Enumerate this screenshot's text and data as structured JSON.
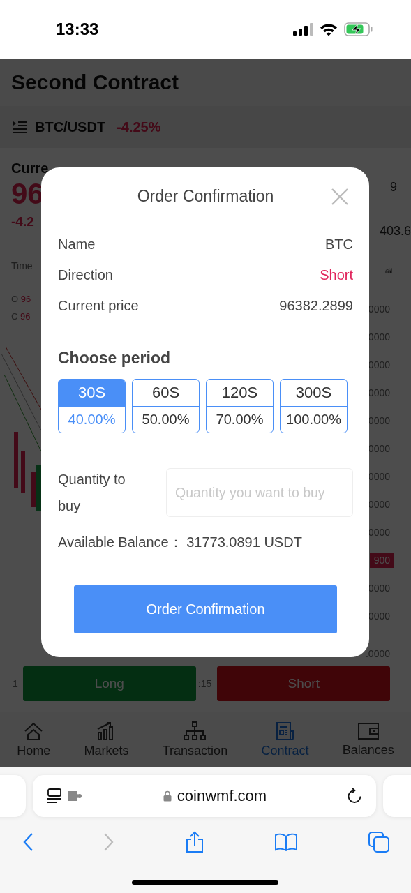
{
  "status_bar": {
    "time": "13:33"
  },
  "header": {
    "title": "Second Contract"
  },
  "pair": {
    "symbol": "BTC/USDT",
    "change": "-4.25%"
  },
  "market": {
    "label": "Curre",
    "price": "96",
    "change": "-4.2",
    "time_label": "Time",
    "open": {
      "label": "O",
      "value": "96"
    },
    "close": {
      "label": "C",
      "value": "96"
    },
    "high_fragment": "9",
    "low_fragment": "403.6",
    "axis_labels": [
      {
        "text": "0000",
        "kind": "plain"
      },
      {
        "text": "0000",
        "kind": "plain"
      },
      {
        "text": "0000",
        "kind": "plain"
      },
      {
        "text": "0000",
        "kind": "plain"
      },
      {
        "text": "0000",
        "kind": "plain"
      },
      {
        "text": "0000",
        "kind": "plain"
      },
      {
        "text": "0000",
        "kind": "plain"
      },
      {
        "text": "0000",
        "kind": "plain"
      },
      {
        "text": "0000",
        "kind": "plain"
      },
      {
        "text": "900",
        "kind": "marker"
      },
      {
        "text": "0000",
        "kind": "plain"
      },
      {
        "text": "0000",
        "kind": "plain"
      },
      {
        "text": ".0000",
        "kind": "plain"
      }
    ]
  },
  "trade": {
    "left_fragment": "1",
    "long": "Long",
    "time_fragment": ":15",
    "short": "Short"
  },
  "modal": {
    "title": "Order Confirmation",
    "rows": [
      {
        "label": "Name",
        "value": "BTC",
        "kind": "plain"
      },
      {
        "label": "Direction",
        "value": "Short",
        "kind": "short"
      },
      {
        "label": "Current price",
        "value": "96382.2899",
        "kind": "plain"
      }
    ],
    "period_title": "Choose period",
    "periods": [
      {
        "time": "30S",
        "rate": "40.00%",
        "selected": true
      },
      {
        "time": "60S",
        "rate": "50.00%",
        "selected": false
      },
      {
        "time": "120S",
        "rate": "70.00%",
        "selected": false
      },
      {
        "time": "300S",
        "rate": "100.00%",
        "selected": false
      }
    ],
    "quantity_label": "Quantity to buy",
    "quantity_placeholder": "Quantity you want to buy",
    "balance_label": "Available Balance：",
    "balance_value": "31773.0891 USDT",
    "confirm_button": "Order Confirmation"
  },
  "nav": [
    {
      "label": "Home",
      "selected": false
    },
    {
      "label": "Markets",
      "selected": false
    },
    {
      "label": "Transaction",
      "selected": false
    },
    {
      "label": "Contract",
      "selected": true
    },
    {
      "label": "Balances",
      "selected": false
    }
  ],
  "browser": {
    "url": "coinwmf.com"
  }
}
